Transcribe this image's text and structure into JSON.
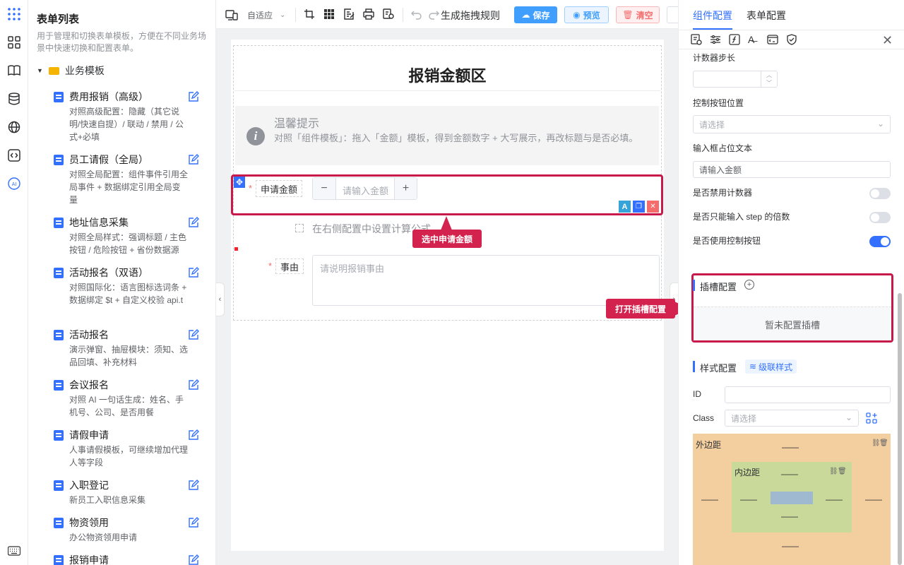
{
  "left_panel": {
    "title": "表单列表",
    "description": "用于管理和切换表单模板，方便在不同业务场景中快速切换和配置表单。",
    "group_label": "业务模板",
    "templates": [
      {
        "name": "费用报销（高级）",
        "desc": "对照高级配置：隐藏（其它说明/快速自提）/ 联动 / 禁用 / 公式+必填"
      },
      {
        "name": "员工请假（全局）",
        "desc": "对照全局配置：组件事件引用全局事件 + 数据绑定引用全局变量"
      },
      {
        "name": "地址信息采集",
        "desc": "对照全局样式：强调标题 / 主色按钮 / 危险按钮 + 省份数据源"
      },
      {
        "name": "活动报名（双语）",
        "desc": "对照国际化：语言图标选词条 + 数据绑定 $t + 自定义校验 api.t"
      },
      {
        "name": "活动报名",
        "desc": "演示弹窗、抽屉模块：须知、选品回填、补充材料"
      },
      {
        "name": "会议报名",
        "desc": "对照 AI 一句话生成：姓名、手机号、公司、是否用餐"
      },
      {
        "name": "请假申请",
        "desc": "人事请假模板，可继续增加代理人等字段"
      },
      {
        "name": "入职登记",
        "desc": "新员工入职信息采集"
      },
      {
        "name": "物资领用",
        "desc": "办公物资领用申请"
      },
      {
        "name": "报销申请",
        "desc": ""
      }
    ]
  },
  "toolbar": {
    "layout_select": "自适应",
    "rule_label": "生成拖拽规则",
    "save_label": "保存",
    "preview_label": "预览",
    "clear_label": "清空"
  },
  "canvas": {
    "form_title": "报销金额区",
    "tip_title": "温馨提示",
    "tip_body": "对照「组件模板」：拖入「金额」模板，得到金额数字 + 大写展示，再改标题与是否必填。",
    "amount_label": "申请金额",
    "amount_placeholder": "请输入金额",
    "formula_hint": "在右侧配置中设置计算公式",
    "reason_label": "事由",
    "reason_placeholder": "请说明报销事由",
    "required_mark": "*",
    "callout_select": "选中申请金额",
    "callout_slot": "打开插槽配置",
    "ai_badge": "A"
  },
  "right_panel": {
    "tab_component": "组件配置",
    "tab_form": "表单配置",
    "step_label": "计数器步长",
    "ctrl_pos_label": "控制按钮位置",
    "ctrl_pos_placeholder": "请选择",
    "placeholder_label": "输入框占位文本",
    "placeholder_value": "请输入金额",
    "switches": [
      {
        "label": "是否禁用计数器",
        "on": false
      },
      {
        "label": "是否只能输入 step 的倍数",
        "on": false
      },
      {
        "label": "是否使用控制按钮",
        "on": true
      }
    ],
    "slot_title": "插槽配置",
    "slot_empty": "暂未配置插槽",
    "style_title": "样式配置",
    "cascade_label": "级联样式",
    "id_label": "ID",
    "class_label": "Class",
    "class_placeholder": "请选择",
    "margin_label": "外边距",
    "padding_label": "内边距",
    "dash": "——"
  },
  "colors": {
    "primary": "#3370ff",
    "save_bg": "#409eff",
    "danger": "#f56c6c",
    "highlight": "#c8194b",
    "margin_bg": "#f3cfa0",
    "padding_bg": "#c9d99a",
    "content_bg": "#9fbad0"
  }
}
